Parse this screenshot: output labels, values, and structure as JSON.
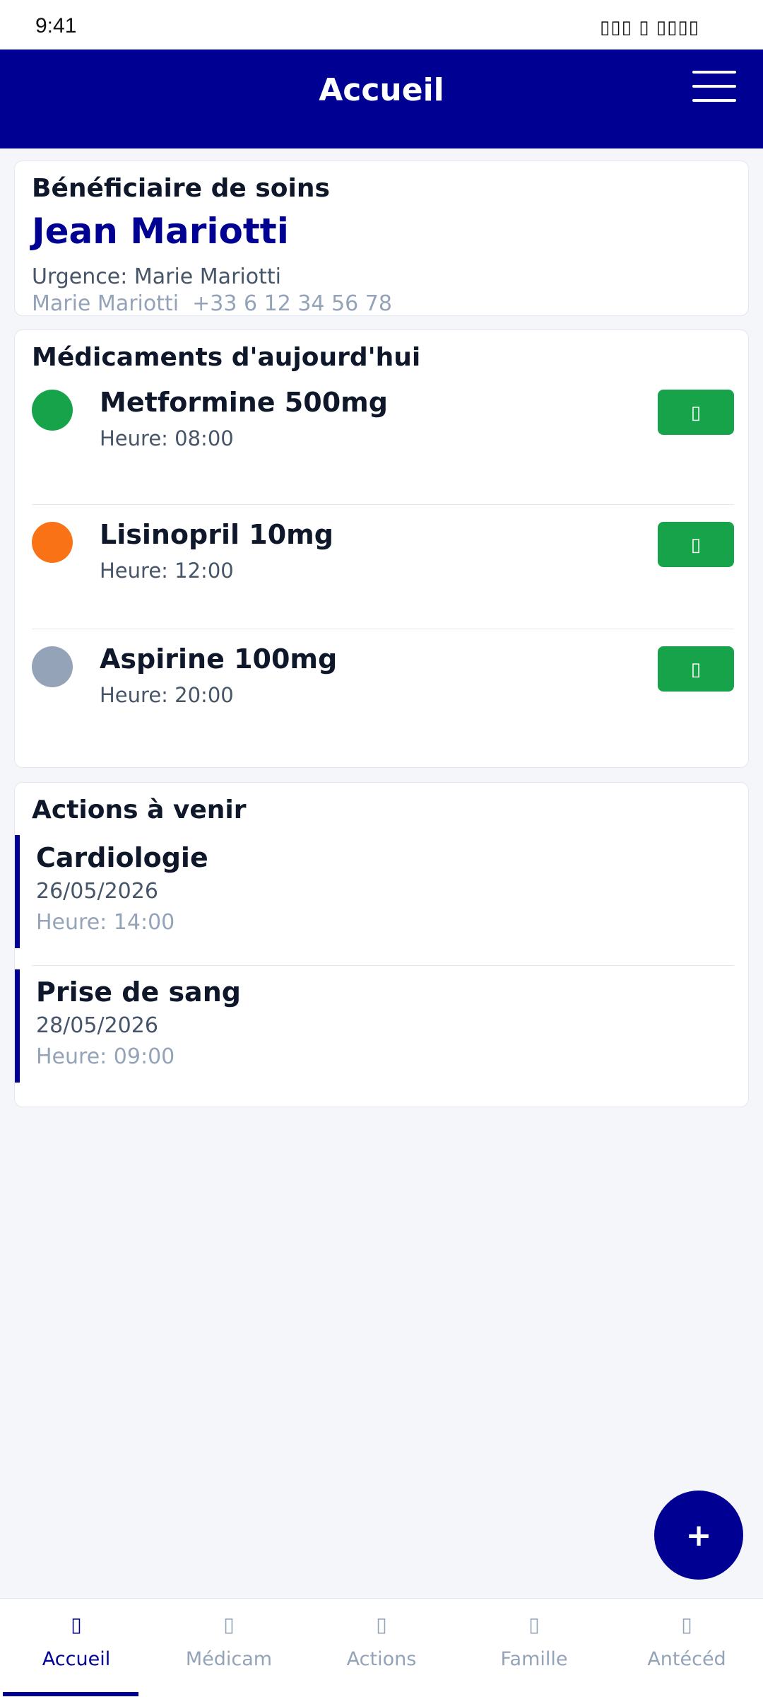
{
  "status_bar": {
    "time": "9:41",
    "icons": "▯▯▯ ▯ ▯▯▯▯"
  },
  "header": {
    "title": "Accueil",
    "menu_icon": "hamburger-menu-icon"
  },
  "beneficiary": {
    "section_title": "Bénéficiaire de soins",
    "name": "Jean Mariotti",
    "urgence": "Urgence: Marie Mariotti",
    "contact": "Marie Mariotti  +33 6 12 34 56 78"
  },
  "medications": {
    "section_title": "Médicaments d'aujourd'hui",
    "items": [
      {
        "name": "Metformine 500mg",
        "time": "Heure: 08:00",
        "status_color": "#16a34a",
        "button_icon": "▯"
      },
      {
        "name": "Lisinopril 10mg",
        "time": "Heure: 12:00",
        "status_color": "#f97316",
        "button_icon": "▯"
      },
      {
        "name": "Aspirine 100mg",
        "time": "Heure: 20:00",
        "status_color": "#94a3b8",
        "button_icon": "▯"
      }
    ]
  },
  "actions": {
    "section_title": "Actions à venir",
    "items": [
      {
        "name": "Cardiologie",
        "date": "26/05/2026",
        "time": "Heure: 14:00"
      },
      {
        "name": "Prise de sang",
        "date": "28/05/2026",
        "time": "Heure: 09:00"
      }
    ]
  },
  "fab": {
    "label": "+"
  },
  "bottom_nav": {
    "items": [
      {
        "label": "Accueil",
        "icon": "▯",
        "active": true
      },
      {
        "label": "Médicam",
        "icon": "▯",
        "active": false
      },
      {
        "label": "Actions",
        "icon": "▯",
        "active": false
      },
      {
        "label": "Famille",
        "icon": "▯",
        "active": false
      },
      {
        "label": "Antécéd",
        "icon": "▯",
        "active": false
      }
    ]
  },
  "colors": {
    "primary": "#000093",
    "success": "#16a34a",
    "warning": "#f97316",
    "muted": "#94a3b8"
  }
}
